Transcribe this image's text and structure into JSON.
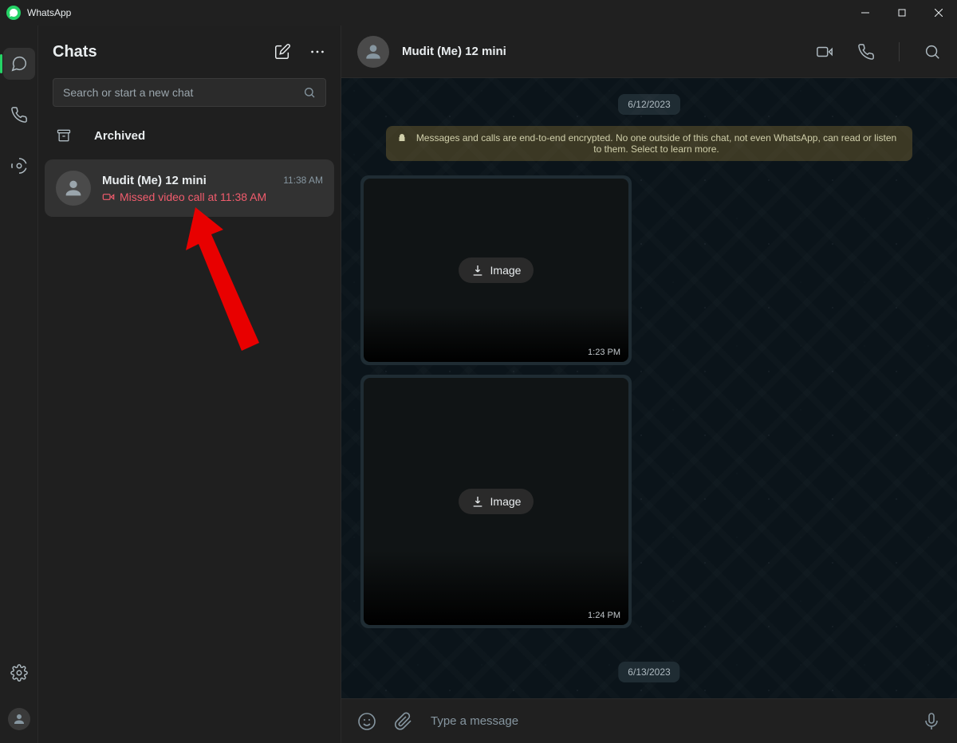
{
  "titlebar": {
    "title": "WhatsApp"
  },
  "sidebar": {
    "header_title": "Chats",
    "search_placeholder": "Search or start a new chat",
    "archived_label": "Archived"
  },
  "chat_row": {
    "name": "Mudit (Me) 12 mini",
    "time": "11:38 AM",
    "subtitle": "Missed video call at 11:38 AM"
  },
  "conversation": {
    "title": "Mudit (Me) 12 mini",
    "date_top": "6/12/2023",
    "date_bottom": "6/13/2023",
    "encryption_notice": "Messages and calls are end-to-end encrypted. No one outside of this chat, not even WhatsApp, can read or listen to them. Select to learn more.",
    "messages": [
      {
        "kind": "image",
        "download_label": "Image",
        "time": "1:23 PM"
      },
      {
        "kind": "image",
        "download_label": "Image",
        "time": "1:24 PM"
      }
    ],
    "composer_placeholder": "Type a message"
  }
}
